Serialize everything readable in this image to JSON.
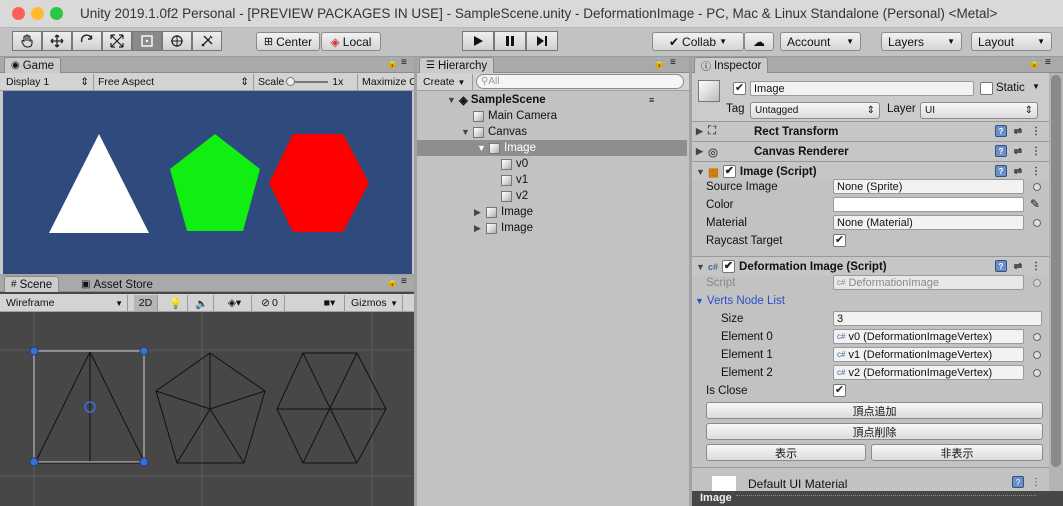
{
  "window": {
    "title": "Unity 2019.1.0f2 Personal - [PREVIEW PACKAGES IN USE] - SampleScene.unity - DeformationImage - PC, Mac & Linux Standalone (Personal) <Metal>"
  },
  "toolbar": {
    "pivot_label": "Center",
    "space_label": "Local",
    "collab_label": "Collab",
    "account_label": "Account",
    "layers_label": "Layers",
    "layout_label": "Layout"
  },
  "game": {
    "tab": "Game",
    "display": "Display 1",
    "aspect": "Free Aspect",
    "scale_label": "Scale",
    "scale_value": "1x",
    "maximize": "Maximize O",
    "bg_color": "#2f4a7d",
    "shapes": [
      {
        "name": "triangle",
        "color": "#ffffff"
      },
      {
        "name": "pentagon",
        "color": "#11ee11"
      },
      {
        "name": "hexagon",
        "color": "#ff0000"
      }
    ]
  },
  "scene": {
    "tab": "Scene",
    "asset_store_tab": "Asset Store",
    "shading": "Wireframe",
    "mode_2d": "2D",
    "hidden_count": "0",
    "gizmos": "Gizmos"
  },
  "hierarchy": {
    "tab": "Hierarchy",
    "create": "Create",
    "search_placeholder": "All",
    "items": [
      {
        "label": "SampleScene"
      },
      {
        "label": "Main Camera"
      },
      {
        "label": "Canvas"
      },
      {
        "label": "Image"
      },
      {
        "label": "v0"
      },
      {
        "label": "v1"
      },
      {
        "label": "v2"
      },
      {
        "label": "Image"
      },
      {
        "label": "Image"
      }
    ]
  },
  "inspector": {
    "tab": "Inspector",
    "object_name": "Image",
    "static_label": "Static",
    "tag_label": "Tag",
    "tag_value": "Untagged",
    "layer_label": "Layer",
    "layer_value": "UI",
    "components": {
      "rect_transform": "Rect Transform",
      "canvas_renderer": "Canvas Renderer",
      "image_script": "Image (Script)",
      "deformation": "Deformation Image (Script)"
    },
    "image": {
      "source_label": "Source Image",
      "source_value": "None (Sprite)",
      "color_label": "Color",
      "material_label": "Material",
      "material_value": "None (Material)",
      "raycast_label": "Raycast Target"
    },
    "deform": {
      "script_label": "Script",
      "script_value": "DeformationImage",
      "list_label": "Verts Node List",
      "size_label": "Size",
      "size_value": "3",
      "elements": [
        {
          "label": "Element 0",
          "value": "v0 (DeformationImageVertex)"
        },
        {
          "label": "Element 1",
          "value": "v1 (DeformationImageVertex)"
        },
        {
          "label": "Element 2",
          "value": "v2 (DeformationImageVertex)"
        }
      ],
      "is_close_label": "Is Close",
      "add_vertex": "頂点追加",
      "delete_vertex": "頂点削除",
      "show": "表示",
      "hide": "非表示"
    },
    "material_footer": "Default UI Material",
    "preview_label": "Image"
  }
}
